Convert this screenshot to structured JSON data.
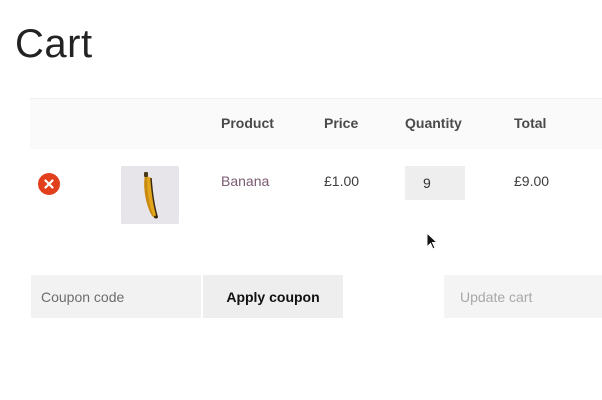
{
  "page": {
    "title": "Cart"
  },
  "cart": {
    "columns": {
      "product": "Product",
      "price": "Price",
      "quantity": "Quantity",
      "total": "Total"
    },
    "items": [
      {
        "name": "Banana",
        "price": "£1.00",
        "quantity": "9",
        "total": "£9.00",
        "thumbnail_icon": "banana-icon"
      }
    ]
  },
  "actions": {
    "coupon_placeholder": "Coupon code",
    "apply_coupon": "Apply coupon",
    "update_cart": "Update cart"
  },
  "colors": {
    "remove": "#e2401c",
    "product_link": "#7a5b72",
    "disabled_text": "#a8a8a8"
  }
}
